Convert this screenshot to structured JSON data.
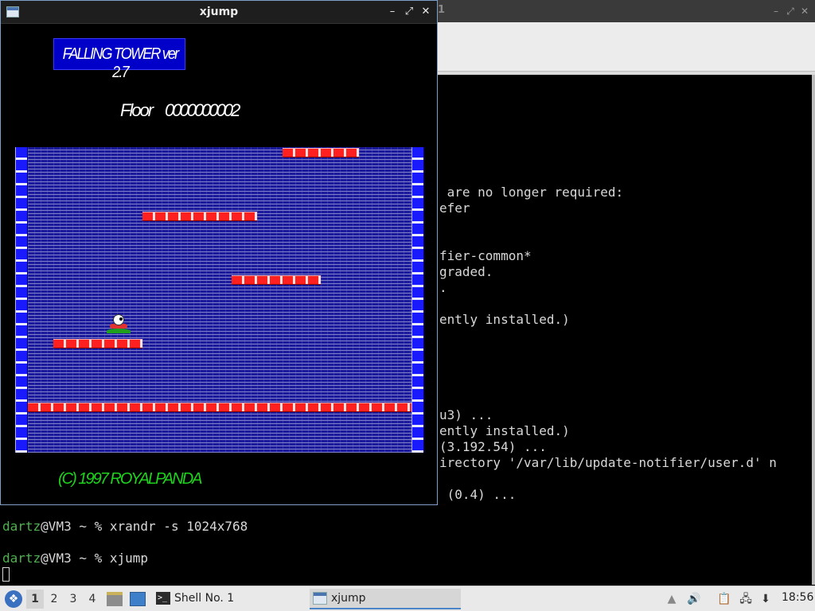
{
  "xjump_window": {
    "title": "xjump",
    "minimize_glyph": "–",
    "restore_glyph": "⤢",
    "close_glyph": "✕"
  },
  "terminal_window": {
    "title_fragment": "1",
    "minimize_glyph": "–",
    "restore_glyph": "⤢",
    "close_glyph": "✕",
    "visible_lines": [
      " are no longer required:",
      "efer",
      "fier-common*",
      "graded.",
      ".",
      "ently installed.)",
      "u3) ...",
      "ently installed.)",
      "(3.192.54) ...",
      "irectory '/var/lib/update-notifier/user.d' n",
      " (0.4) ..."
    ]
  },
  "game": {
    "title": "FALLING TOWER ver 2.7",
    "floor_label": "Floor",
    "floor_value": "0000000002",
    "copyright": "(C) 1997 ROYALPANDA"
  },
  "shell": {
    "prompt_user": "dartz",
    "prompt_rest": "@VM3 ~ % ",
    "command1": "xrandr -s 1024x768",
    "command2": "xjump"
  },
  "taskbar": {
    "workspaces": [
      "1",
      "2",
      "3",
      "4"
    ],
    "active_workspace": "1",
    "tasks": [
      {
        "label": "Shell No. 1",
        "icon": "terminal-icon"
      },
      {
        "label": "xjump",
        "icon": "window-icon"
      }
    ],
    "clock": "18:56"
  },
  "colors": {
    "prompt_user": "#4fb04f",
    "game_title_bg": "#0000c8",
    "copyright": "#1ed21e",
    "bricks": "#ff2020",
    "walls": "#0000ff"
  }
}
